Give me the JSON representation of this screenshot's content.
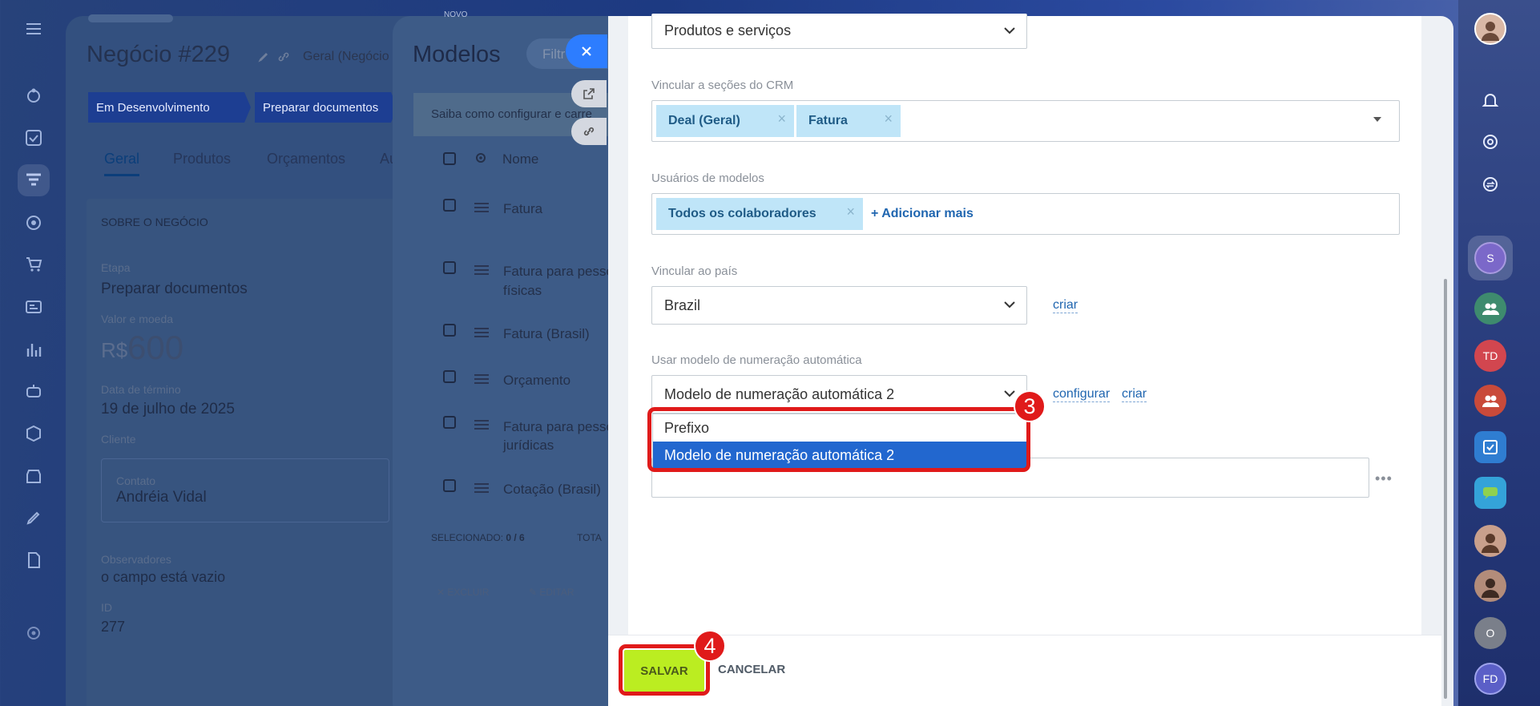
{
  "deal": {
    "title": "Negócio #229",
    "pipeline": "Geral (Negócio",
    "stages": [
      "Em Desenvolvimento",
      "Preparar documentos"
    ],
    "tabs": [
      "Geral",
      "Produtos",
      "Orçamentos",
      "Au"
    ],
    "section_title": "SOBRE O NEGÓCIO",
    "stage_label": "Etapa",
    "stage_value": "Preparar documentos",
    "amount_label": "Valor e moeda",
    "currency": "R$",
    "amount": "600",
    "date_label": "Data de término",
    "date_value": "19 de julho de 2025",
    "client_label": "Cliente",
    "contact_label": "Contato",
    "contact_value": "Andréia Vidal",
    "observers_label": "Observadores",
    "observers_value": "o campo está vazio",
    "id_label": "ID",
    "id_value": "277"
  },
  "models": {
    "top_label": "NOVO",
    "title": "Modelos",
    "filter_placeholder": "Filtr",
    "info_text": "Saiba como configurar e carre",
    "header_name": "Nome",
    "rows": [
      "Fatura",
      "Fatura para pesso",
      "físicas",
      "Fatura (Brasil)",
      "Orçamento",
      "Fatura para pesso",
      "jurídicas",
      "Cotação (Brasil)"
    ],
    "selected_label": "SELECIONADO:",
    "selected_count": "0 / 6",
    "total_label": "TOTA",
    "delete_label": "EXCLUIR",
    "edit_label": "EDITAR"
  },
  "form": {
    "entity_select": "Produtos e serviços",
    "crm_label": "Vincular a seções do CRM",
    "crm_tags": [
      "Deal (Geral)",
      "Fatura"
    ],
    "users_label": "Usuários de modelos",
    "users_tag": "Todos os colaboradores",
    "add_more": "+ Adicionar mais",
    "country_label": "Vincular ao país",
    "country_value": "Brazil",
    "create_link": "criar",
    "numbering_label": "Usar modelo de numeração automática",
    "numbering_value": "Modelo de numeração automática 2",
    "configure_link": "configurar",
    "create_link2": "criar",
    "dropdown_options": [
      "Prefixo",
      "Modelo de numeração automática 2"
    ],
    "badge_3": "3",
    "badge_4": "4",
    "save": "SALVAR",
    "cancel": "CANCELAR"
  },
  "right_rail": {
    "avatar_initials": [
      "S",
      "TD",
      "O",
      "FD"
    ]
  },
  "colors": {
    "accent": "#2267cf",
    "save_button": "#bbed21",
    "highlight": "#e01a1a",
    "tag_bg": "#bfe5f8"
  }
}
